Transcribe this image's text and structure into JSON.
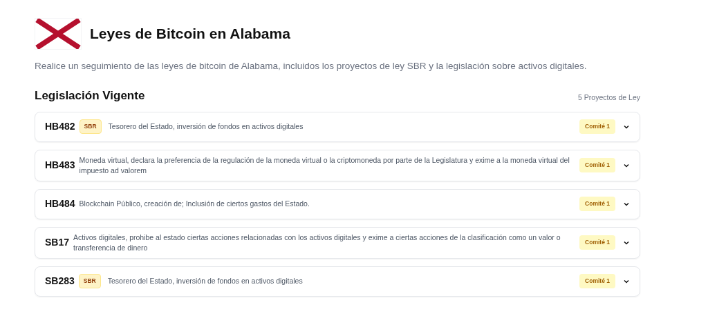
{
  "header": {
    "title": "Leyes de Bitcoin en Alabama",
    "subtitle": "Realice un seguimiento de las leyes de bitcoin de Alabama, incluidos los proyectos de ley SBR y la legislación sobre activos digitales."
  },
  "section": {
    "title": "Legislación Vigente",
    "count": "5 Proyectos de Ley"
  },
  "bills": [
    {
      "id": "HB482",
      "tag": "SBR",
      "description": "Tesorero del Estado, inversión de fondos en activos digitales",
      "status": "Comité 1",
      "expanded": false
    },
    {
      "id": "HB483",
      "description": "Moneda virtual, declara la preferencia de la regulación de la moneda virtual o la criptomoneda por parte de la Legislatura y exime a la moneda virtual del impuesto ad valorem",
      "status": "Comité 1",
      "expanded": false
    },
    {
      "id": "HB484",
      "description": "Blockchain Público, creación de; Inclusión de ciertos gastos del Estado.",
      "status": "Comité 1",
      "expanded": false
    },
    {
      "id": "SB17",
      "description": "Activos digitales, prohibe al estado ciertas acciones relacionadas con los activos digitales y exime a ciertas acciones de la clasificación como un valor o transferencia de dinero",
      "status": "Comité 1",
      "expanded": false
    },
    {
      "id": "SB283",
      "tag": "SBR",
      "description": "Tesorero del Estado, inversión de fondos en activos digitales",
      "status": "Comité 1",
      "expanded": false
    }
  ]
}
